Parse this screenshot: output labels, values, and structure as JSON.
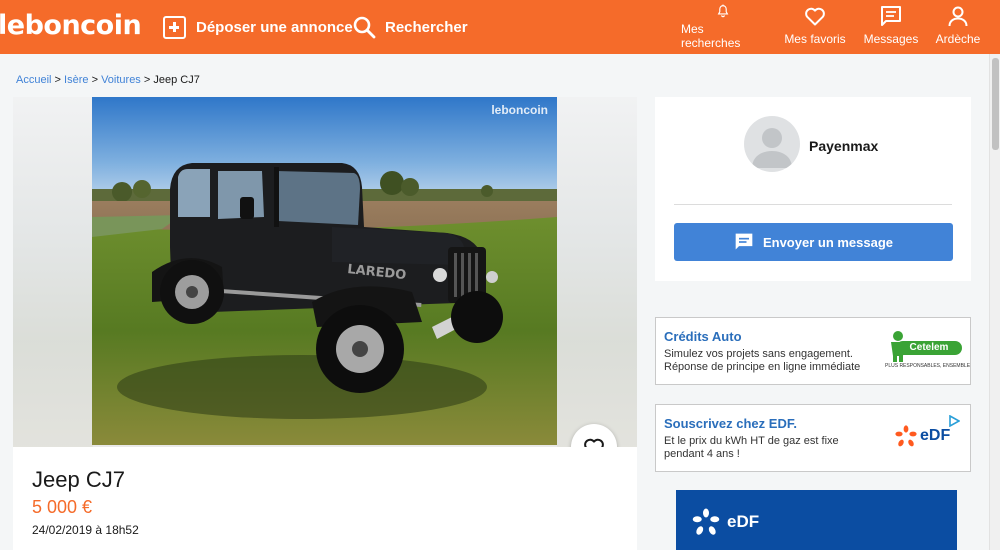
{
  "header": {
    "logo": "leboncoin",
    "deposer_label": "Déposer une annonce",
    "rechercher_label": "Rechercher",
    "nav": [
      {
        "icon": "bell-icon",
        "label": "Mes recherches"
      },
      {
        "icon": "heart-icon",
        "label": "Mes favoris"
      },
      {
        "icon": "message-icon",
        "label": "Messages"
      },
      {
        "icon": "user-icon",
        "label": "Ardèche"
      }
    ],
    "brand_color": "#f56b2a"
  },
  "breadcrumb": {
    "items": [
      "Accueil",
      "Isère",
      "Voitures"
    ],
    "current": "Jeep CJ7",
    "separator": ">"
  },
  "listing": {
    "watermark": "leboncoin",
    "title": "Jeep CJ7",
    "price": "5 000 €",
    "date": "24/02/2019 à 18h52"
  },
  "seller": {
    "name": "Payenmax",
    "message_button": "Envoyer un message",
    "button_color": "#4183d7"
  },
  "ads": [
    {
      "title": "Crédits Auto",
      "text": "Simulez vos projets sans engagement. Réponse de principe en ligne immédiate",
      "logo_name": "Cetelem",
      "logo_tagline": "PLUS RESPONSABLES, ENSEMBLE"
    },
    {
      "title": "Souscrivez chez EDF.",
      "text": "Et le prix du kWh HT de gaz est fixe pendant 4 ans !",
      "logo_name": "eDF"
    }
  ],
  "banner": {
    "logo_name": "eDF"
  }
}
